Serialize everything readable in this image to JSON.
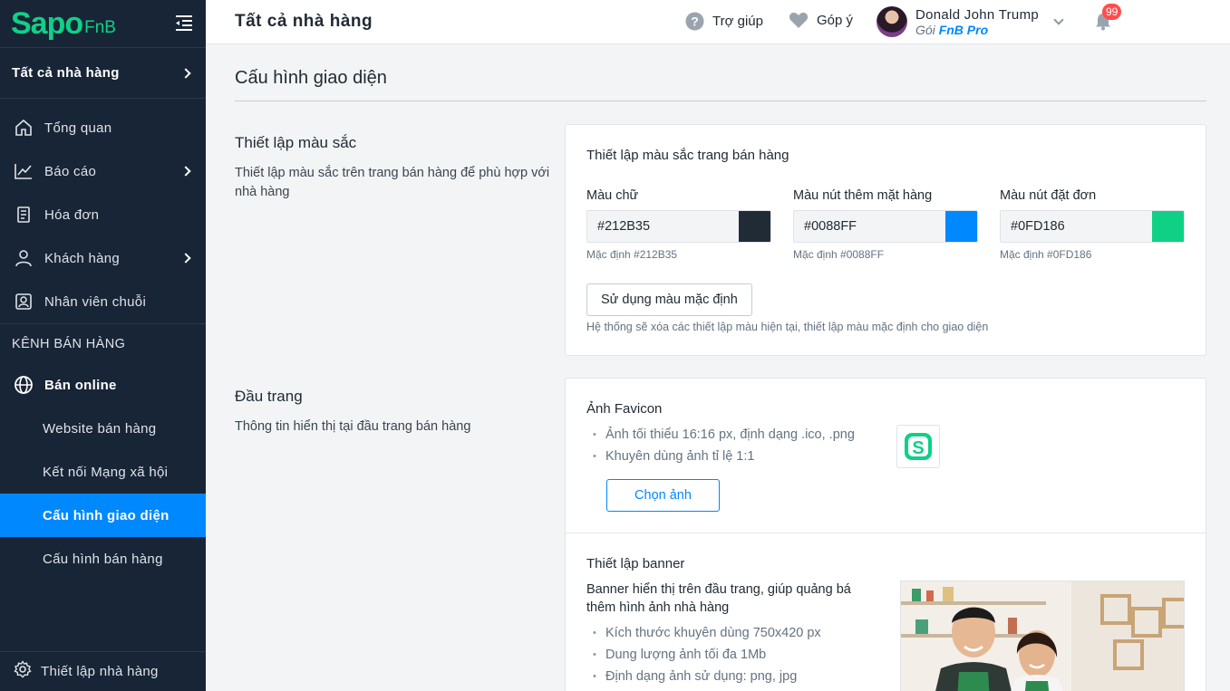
{
  "brand": {
    "name": "Sapo",
    "suffix": "FnB",
    "accent": "#0088FF",
    "green": "#0FD186",
    "sidebar_bg": "#182537"
  },
  "sidebar": {
    "store_selector": "Tất cả nhà hàng",
    "items": [
      {
        "label": "Tổng quan",
        "icon": "home-icon"
      },
      {
        "label": "Báo cáo",
        "icon": "chart-icon",
        "has_children": true
      },
      {
        "label": "Hóa đơn",
        "icon": "receipt-icon"
      },
      {
        "label": "Khách hàng",
        "icon": "user-icon",
        "has_children": true
      },
      {
        "label": "Nhân viên chuỗi",
        "icon": "staff-icon"
      }
    ],
    "section_label": "KÊNH BÁN HÀNG",
    "channel": {
      "label": "Bán online",
      "icon": "globe-icon"
    },
    "sub_items": [
      {
        "label": "Website bán hàng"
      },
      {
        "label": "Kết nối Mạng xã hội"
      },
      {
        "label": "Cấu hình giao diện",
        "active": true
      },
      {
        "label": "Cấu hình bán hàng"
      }
    ],
    "footer": {
      "label": "Thiết lập nhà hàng",
      "icon": "gear-icon"
    }
  },
  "header": {
    "title": "Tất cả nhà hàng",
    "help_label": "Trợ giúp",
    "feedback_label": "Góp ý",
    "user": {
      "name": "Donald John Trump",
      "plan_prefix": "Gói",
      "plan": "FnB Pro"
    },
    "notification_count": "99"
  },
  "main": {
    "page_title": "Cấu hình giao diện",
    "colors_section": {
      "title": "Thiết lập màu sắc",
      "description": "Thiết lập màu sắc trên trang bán hàng để phù hợp với nhà hàng",
      "card_title": "Thiết lập màu sắc trang bán hàng",
      "fields": [
        {
          "label": "Màu chữ",
          "value": "#212B35",
          "swatch": "#212B35",
          "default_text": "Mặc định  #212B35"
        },
        {
          "label": "Màu nút thêm mặt hàng",
          "value": "#0088FF",
          "swatch": "#0088FF",
          "default_text": "Mặc định  #0088FF"
        },
        {
          "label": "Màu nút đặt đơn",
          "value": "#0FD186",
          "swatch": "#0FD186",
          "default_text": "Mặc định  #0FD186"
        }
      ],
      "reset_button": "Sử dụng màu mặc định",
      "reset_hint": "Hệ thống sẽ xóa các thiết lập màu hiện tại, thiết lập màu mặc định cho giao diện"
    },
    "header_section": {
      "title": "Đầu trang",
      "description": "Thông tin hiển thị tại đầu trang bán hàng",
      "favicon": {
        "title": "Ảnh Favicon",
        "bullets": [
          "Ảnh tối thiểu 16:16 px, định dạng .ico, .png",
          "Khuyên dùng ảnh tỉ lệ 1:1"
        ],
        "button": "Chọn ảnh"
      },
      "banner": {
        "title": "Thiết lập banner",
        "description": "Banner hiển thị trên đầu trang, giúp quảng bá thêm hình ảnh nhà hàng",
        "bullets": [
          "Kích thước khuyên dùng 750x420 px",
          "Dung lượng ảnh tối đa 1Mb",
          "Định dạng ảnh sử dụng: png, jpg"
        ]
      }
    }
  }
}
